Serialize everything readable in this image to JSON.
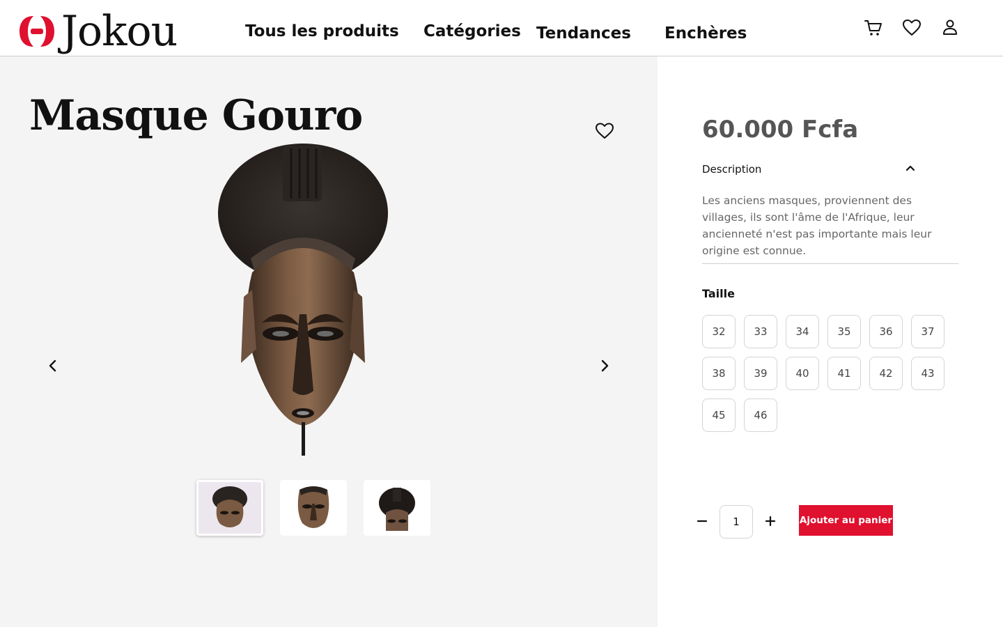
{
  "brand": {
    "name": "Jokou",
    "logo_color": "#e0102f"
  },
  "nav": {
    "items": [
      {
        "label": "Tous les produits"
      },
      {
        "label": "Catégories"
      },
      {
        "label": "Tendances"
      },
      {
        "label": "Enchères"
      }
    ]
  },
  "header_icons": [
    "cart-icon",
    "heart-icon",
    "user-icon"
  ],
  "product": {
    "title": "Masque Gouro",
    "price": "60.000 Fcfa",
    "description_label": "Description",
    "description": "Les anciens masques, proviennent des villages, ils sont l'âme de l'Afrique, leur ancienneté n'est pas importante mais leur origine est connue.",
    "size_label": "Taille",
    "sizes": [
      "32",
      "33",
      "34",
      "35",
      "36",
      "37",
      "38",
      "39",
      "40",
      "41",
      "42",
      "43",
      "45",
      "46"
    ],
    "quantity": "1",
    "add_to_cart_label": "Ajouter au panier"
  },
  "gallery": {
    "thumbnail_count": 3,
    "selected_thumbnail": 1
  },
  "colors": {
    "accent": "#e0102f",
    "panel_bg": "#f4f4f4",
    "price": "#555555"
  }
}
